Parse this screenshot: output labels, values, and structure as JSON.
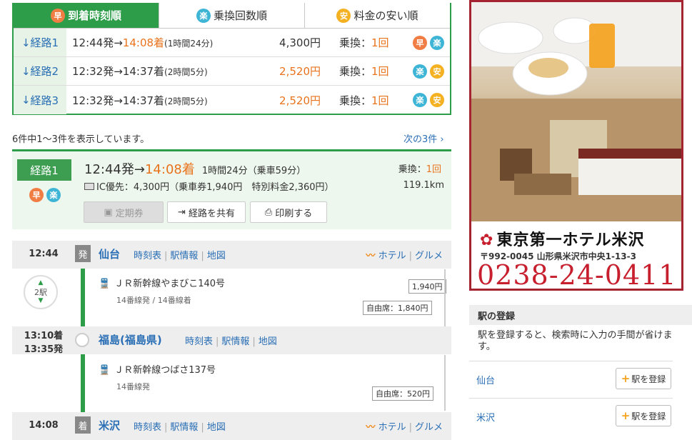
{
  "sort_tabs": [
    {
      "icon": "早",
      "label": "到着時刻順",
      "active": true
    },
    {
      "icon": "楽",
      "label": "乗換回数順",
      "active": false
    },
    {
      "icon": "安",
      "label": "料金の安い順",
      "active": false
    }
  ],
  "routes": [
    {
      "label": "経路1",
      "dep": "12:44発→",
      "arr": "14:08着",
      "dur": "(1時間24分)",
      "fare": "4,300円",
      "trans_label": "乗換：",
      "trans": "1回",
      "arr_highlight": true,
      "fare_highlight": false,
      "badges": [
        "早",
        "楽"
      ]
    },
    {
      "label": "経路2",
      "dep": "12:32発→",
      "arr": "14:37着",
      "dur": "(2時間5分)",
      "fare": "2,520円",
      "trans_label": "乗換：",
      "trans": "1回",
      "arr_highlight": false,
      "fare_highlight": true,
      "badges": [
        "楽",
        "安"
      ]
    },
    {
      "label": "経路3",
      "dep": "12:32発→",
      "arr": "14:37着",
      "dur": "(2時間5分)",
      "fare": "2,520円",
      "trans_label": "乗換：",
      "trans": "1回",
      "arr_highlight": false,
      "fare_highlight": true,
      "badges": [
        "楽",
        "安"
      ]
    }
  ],
  "result_count": "6件中1～3件を表示しています。",
  "next_link": "次の3件",
  "summary": {
    "label": "経路1",
    "badge1": "早",
    "badge2": "楽",
    "dep": "12:44発→",
    "arr": "14:08着",
    "dur": "1時間24分（乗車59分）",
    "ic": "IC優先：4,300円（乗車券1,940円　特別料金2,360円）",
    "trans_label": "乗換：",
    "trans": "1回",
    "distance": "119.1km",
    "btn_pass": "定期券",
    "btn_share": "経路を共有",
    "btn_print": "印刷する"
  },
  "timeline": {
    "s1": {
      "time": "12:44",
      "mark": "発",
      "name": "仙台"
    },
    "s2": {
      "time1": "13:10着",
      "time2": "13:35発",
      "name": "福島(福島県)"
    },
    "s3": {
      "time": "14:08",
      "mark": "着",
      "name": "米沢"
    },
    "links": {
      "timetable": "時刻表",
      "info": "駅情報",
      "map": "地図",
      "hotel": "ホテル",
      "gourmet": "グルメ"
    },
    "seg1": {
      "train": "ＪＲ新幹線やまびこ140号",
      "platform": "14番線発 / 14番線着",
      "stops": "2駅",
      "fare": "1,940円",
      "seat": "自由席：1,840円"
    },
    "seg2": {
      "train": "ＪＲ新幹線つばさ137号",
      "platform": "14番線発",
      "seat": "自由席：520円"
    }
  },
  "ad": {
    "name": "東京第一ホテル米沢",
    "address": "〒992-0045 山形県米沢市中央1-13-3",
    "tel": "0238-24-0411"
  },
  "register": {
    "title": "駅の登録",
    "desc": "駅を登録すると、検索時に入力の手間が省けます。",
    "stations": [
      "仙台",
      "米沢"
    ],
    "btn": "駅を登録"
  },
  "colors": {
    "green": "#2d9d4a",
    "orange": "#e8731c",
    "link": "#2a6fb5",
    "ad_red": "#c71f2e"
  }
}
